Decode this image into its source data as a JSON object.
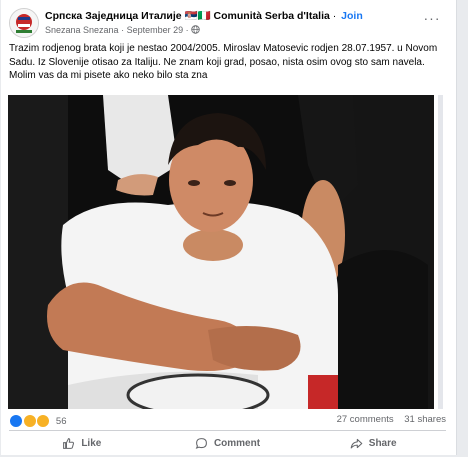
{
  "header": {
    "group_name": "Српска Заједница Италије 🇷🇸🇮🇹 Comunità Serba d'Italia",
    "separator": "·",
    "join_label": "Join",
    "author": "Snezana Snezana",
    "date": "September 29",
    "privacy_icon": "globe-icon",
    "more_label": "···"
  },
  "post": {
    "text": "Trazim rodjenog brata koji je nestao 2004/2005. Miroslav Matosevic rodjen 28.07.1957. u Novom Sadu. Iz Slovenije otisao za Italiju. Ne znam koji grad, posao, nista osim ovog sto sam navela. Molim vas da mi pisete ako neko bilo sta zna"
  },
  "stats": {
    "reaction_icons": [
      "like-reaction-icon",
      "care-reaction-icon",
      "sad-reaction-icon"
    ],
    "reaction_count": "56",
    "comments": "27 comments",
    "shares": "31 shares"
  },
  "actions": {
    "like": "Like",
    "comment": "Comment",
    "share": "Share"
  },
  "colors": {
    "accent": "#1877f2",
    "secondary_text": "#65676b",
    "card_bg": "#ffffff"
  }
}
